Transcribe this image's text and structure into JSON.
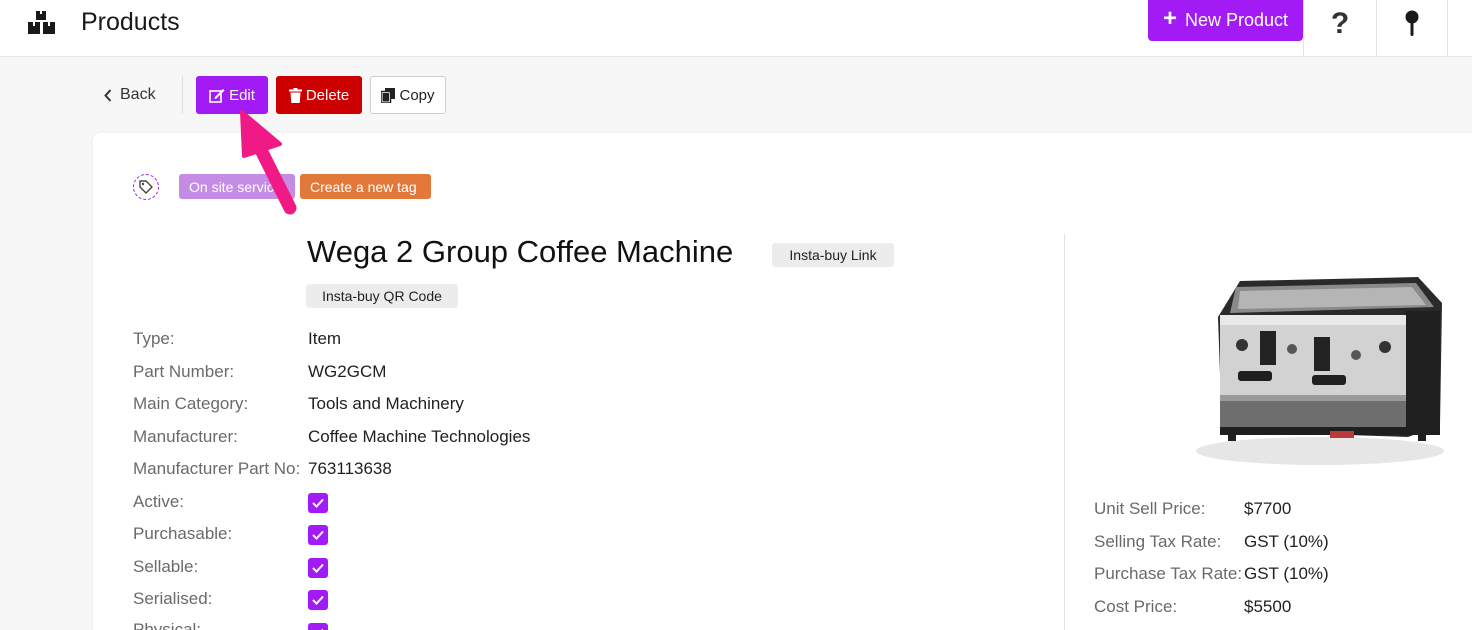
{
  "header": {
    "title": "Products",
    "new_button_label": "New Product",
    "help_glyph": "?",
    "icons": [
      "boxes-logo-icon",
      "plus-icon",
      "question-icon",
      "pin-icon"
    ]
  },
  "actions": {
    "back_label": "Back",
    "edit_label": "Edit",
    "delete_label": "Delete",
    "copy_label": "Copy"
  },
  "tags": [
    {
      "label": "On site servic",
      "color": "#c58ce6"
    },
    {
      "label": "Create a new tag",
      "color": "#e2783a"
    }
  ],
  "product": {
    "name": "Wega 2 Group Coffee Machine",
    "insta_link_label": "Insta-buy Link",
    "insta_qr_label": "Insta-buy QR Code"
  },
  "fields": [
    {
      "label": "Type:",
      "value": "Item"
    },
    {
      "label": "Part Number:",
      "value": "WG2GCM"
    },
    {
      "label": "Main Category:",
      "value": "Tools and Machinery"
    },
    {
      "label": "Manufacturer:",
      "value": "Coffee Machine Technologies"
    },
    {
      "label": "Manufacturer Part No:",
      "value": "763113638"
    }
  ],
  "flags": [
    {
      "label": "Active:",
      "checked": true
    },
    {
      "label": "Purchasable:",
      "checked": true
    },
    {
      "label": "Sellable:",
      "checked": true
    },
    {
      "label": "Serialised:",
      "checked": true
    },
    {
      "label": "Physical:",
      "checked": true
    }
  ],
  "pricing": [
    {
      "label": "Unit Sell Price:",
      "value": "$7700"
    },
    {
      "label": "Selling Tax Rate:",
      "value": "GST (10%)"
    },
    {
      "label": "Purchase Tax Rate:",
      "value": "GST (10%)"
    },
    {
      "label": "Cost Price:",
      "value": "$5500"
    }
  ],
  "colors": {
    "accent": "#a21bf5",
    "danger": "#cc0000",
    "arrow": "#f01a86"
  }
}
